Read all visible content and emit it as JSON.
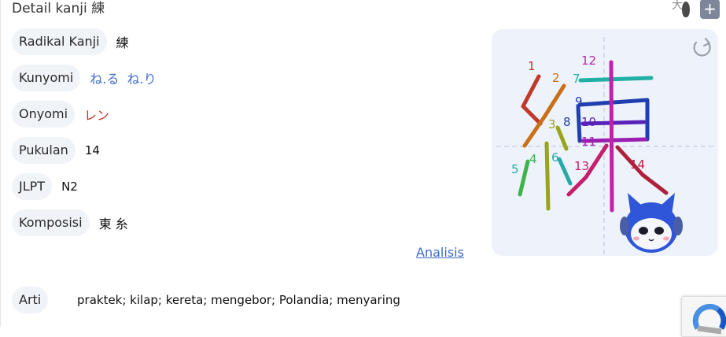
{
  "header": {
    "title": "Detail kanji 練",
    "size_icon_char": "大",
    "add_label": "+"
  },
  "details": [
    {
      "label": "Radikal Kanji",
      "value": "練"
    },
    {
      "label": "Kunyomi",
      "value": "ね.る  ね.り"
    },
    {
      "label": "Onyomi",
      "value": "レン"
    },
    {
      "label": "Pukulan",
      "value": "14"
    },
    {
      "label": "JLPT",
      "value": "N2"
    },
    {
      "label": "Komposisi",
      "value": "東 糸"
    }
  ],
  "analysis_link": "Analisis",
  "meaning": {
    "label": "Arti",
    "value": "praktek; kilap; kereta; mengebor; Polandia; menyaring"
  },
  "stroke_diagram": {
    "stroke_numbers": [
      "1",
      "2",
      "3",
      "4",
      "5",
      "6",
      "7",
      "8",
      "9",
      "10",
      "11",
      "12",
      "13",
      "14"
    ],
    "stroke_colors": {
      "1": "#c0392b",
      "2": "#c8701a",
      "3": "#9aa41a",
      "4": "#3cb44b",
      "5": "#3cb44b",
      "6": "#2aa8a8",
      "7": "#21b0a6",
      "8": "#1f3fb0",
      "9": "#1f3fb0",
      "10": "#5a22b8",
      "11": "#9a1fb0",
      "12": "#c41fa8",
      "13": "#c41f6a",
      "14": "#b01f3c"
    },
    "icons": [
      "replay-icon",
      "mascot-robot-icon"
    ]
  },
  "colors": {
    "chip_bg": "#f0f3f8",
    "kunyomi": "#3f6fc8",
    "onyomi": "#c0392b",
    "panel_bg": "#eef3fb"
  }
}
